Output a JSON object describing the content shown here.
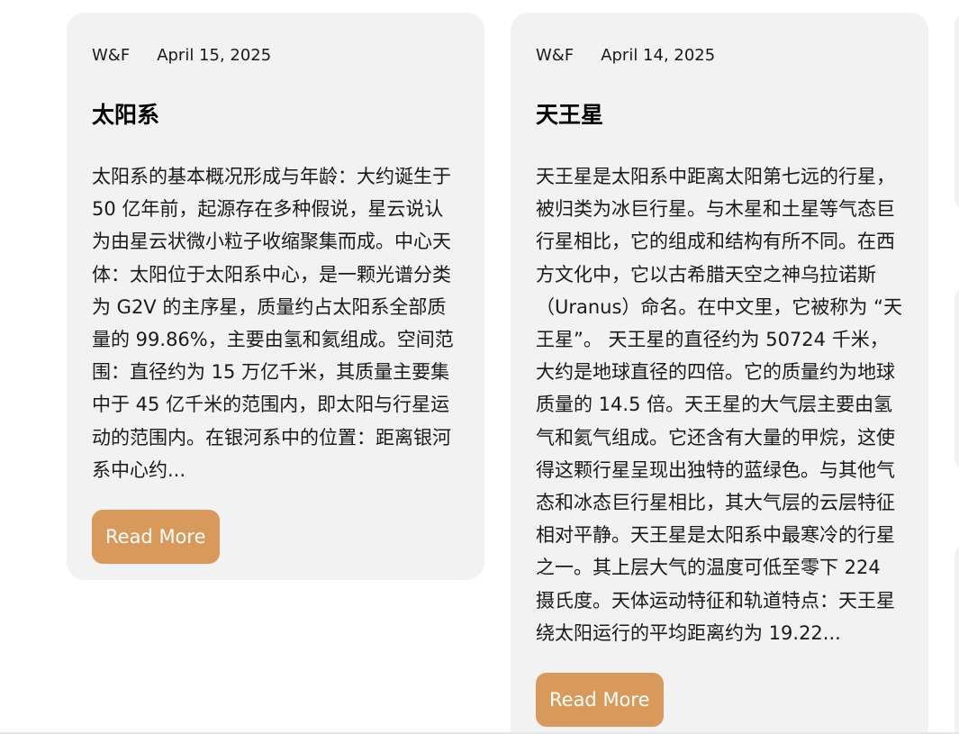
{
  "posts": [
    {
      "author": "W&F",
      "date": "April 15, 2025",
      "title": "太阳系",
      "excerpt": "太阳系的基本概况形成与年龄：大约诞生于 50 亿年前，起源存在多种假说，星云说认为由星云状微小粒子收缩聚集而成。中心天体：太阳位于太阳系中心，是一颗光谱分类为 G2V 的主序星，质量约占太阳系全部质量的 99.86%，主要由氢和氦组成。空间范围：直径约为 15 万亿千米，其质量主要集中于 45 亿千米的范围内，即太阳与行星运动的范围内。在银河系中的位置：距离银河系中心约...",
      "read_more_label": "Read More"
    },
    {
      "author": "W&F",
      "date": "April 14, 2025",
      "title": "天王星",
      "excerpt": "天王星是太阳系中距离太阳第七远的行星，被归类为冰巨行星。与木星和土星等气态巨行星相比，它的组成和结构有所不同。在西方文化中，它以古希腊天空之神乌拉诺斯（Uranus）命名。在中文里，它被称为 “天王星”。 天王星的直径约为 50724 千米，大约是地球直径的四倍。它的质量约为地球质量的 14.5 倍。天王星的大气层主要由氢气和氦气组成。它还含有大量的甲烷，这使得这颗行星呈现出独特的蓝绿色。与其他气态和冰态巨行星相比，其大气层的云层特征相对平静。天王星是太阳系中最寒冷的行星之一。其上层大气的温度可低至零下 224 摄氏度。天体运动特征和轨道特点：天王星绕太阳运行的平均距离约为 19.22...",
      "read_more_label": "Read More"
    }
  ],
  "colors": {
    "card_bg": "#f2f2f2",
    "button_bg": "#d9995a",
    "button_text": "#ffffff"
  }
}
